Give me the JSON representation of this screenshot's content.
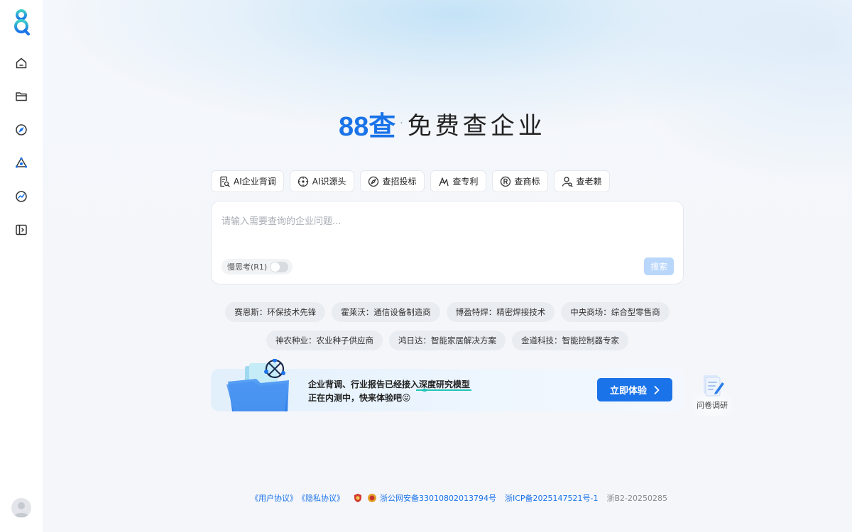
{
  "sidebar": {
    "items": [
      {
        "id": "home",
        "icon": "home-icon"
      },
      {
        "id": "folder",
        "icon": "folder-icon"
      },
      {
        "id": "explore",
        "icon": "compass-icon"
      },
      {
        "id": "ai",
        "icon": "ai-network-icon"
      },
      {
        "id": "trend",
        "icon": "trend-icon"
      },
      {
        "id": "collapse",
        "icon": "sidebar-toggle-icon"
      }
    ]
  },
  "hero": {
    "brand": "88查",
    "separator": "·",
    "slogan": "免费查企业"
  },
  "tools": [
    {
      "label": "AI企业背调",
      "icon": "doc-search-icon"
    },
    {
      "label": "AI识源头",
      "icon": "crosshair-icon"
    },
    {
      "label": "查招投标",
      "icon": "compass-icon"
    },
    {
      "label": "查专利",
      "icon": "patent-icon"
    },
    {
      "label": "查商标",
      "icon": "registered-icon"
    },
    {
      "label": "查老赖",
      "icon": "user-search-icon"
    }
  ],
  "search": {
    "placeholder": "请输入需要查询的企业问题...",
    "value": "",
    "deep_think_label": "慢思考(R1)",
    "submit_label": "搜索"
  },
  "suggestions": [
    "赛恩斯：环保技术先锋",
    "霍莱沃：通信设备制造商",
    "博盈特焊：精密焊接技术",
    "中央商场：综合型零售商",
    "神农种业：农业种子供应商",
    "鸿日达：智能家居解决方案",
    "金道科技：智能控制器专家"
  ],
  "promo": {
    "line1_prefix": "企业背调、行业报告已经接入",
    "line1_highlight": "深度研究模型",
    "line2": "正在内测中，快来体验吧😝",
    "button_label": "立即体验"
  },
  "survey": {
    "label": "问卷调研"
  },
  "footer": {
    "user_agreement": "《用户协议》",
    "privacy_agreement": "《隐私协议》",
    "police_record": "浙公网安备33010802013794号",
    "icp_record": "浙ICP备2025147521号-1",
    "b2_license": "浙B2-20250285"
  },
  "colors": {
    "brand": "#1a73e8",
    "teal": "#22c3b6",
    "disabled_button": "#b9d6fb"
  }
}
